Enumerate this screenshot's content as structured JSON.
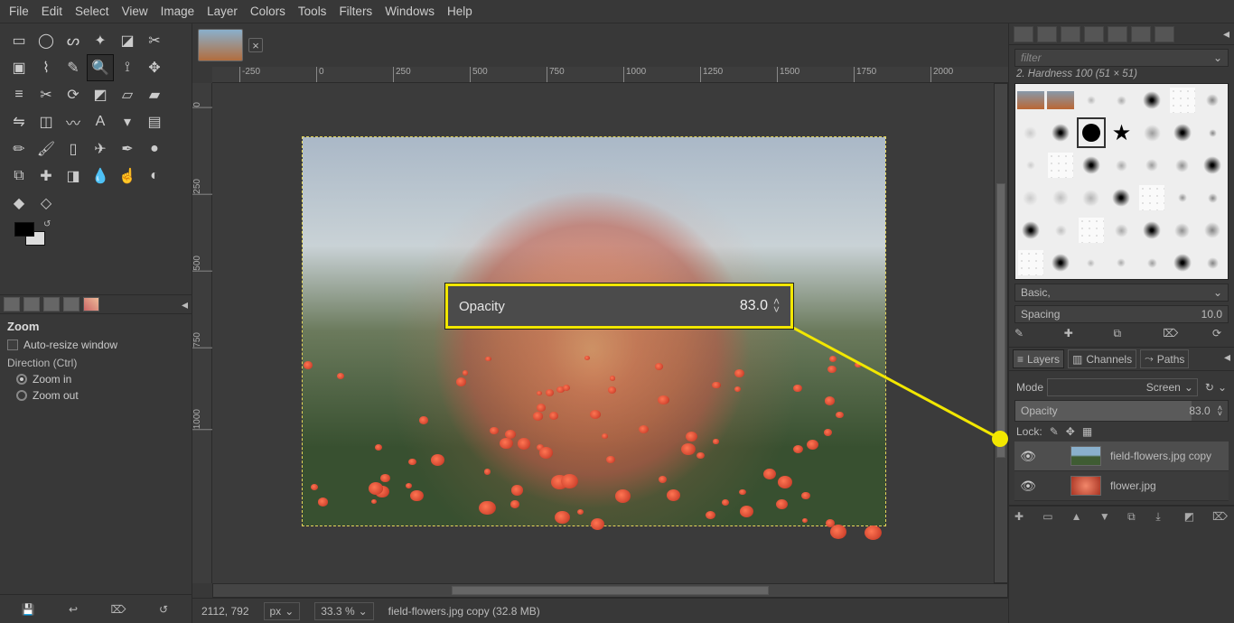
{
  "menu": [
    "File",
    "Edit",
    "Select",
    "View",
    "Image",
    "Layer",
    "Colors",
    "Tools",
    "Filters",
    "Windows",
    "Help"
  ],
  "toolbox": {
    "rows": [
      [
        "rect-select",
        "ellipse-select",
        "free-select",
        "fuzzy-select",
        "color-select",
        "scissors"
      ],
      [
        "foreground-select",
        "paths",
        "color-picker",
        "zoom",
        "measure",
        "move"
      ],
      [
        "align",
        "crop",
        "rotate",
        "scale",
        "shear",
        "perspective"
      ],
      [
        "flip",
        "cage",
        "warp",
        "text",
        "bucket",
        "gradient"
      ],
      [
        "pencil",
        "paintbrush",
        "eraser",
        "airbrush",
        "ink",
        "mypaint"
      ],
      [
        "clone",
        "heal",
        "perspective-clone",
        "blur",
        "smudge",
        "dodge"
      ],
      [
        "more1",
        "more2",
        "",
        "",
        "",
        ""
      ]
    ],
    "selected": "zoom"
  },
  "tool_options": {
    "title": "Zoom",
    "auto_resize_label": "Auto-resize window",
    "auto_resize": false,
    "direction_label": "Direction  (Ctrl)",
    "zoom_in_label": "Zoom in",
    "zoom_out_label": "Zoom out",
    "direction": "in"
  },
  "ruler_h": [
    -250,
    0,
    250,
    500,
    750,
    1000,
    1250,
    1500,
    1750,
    2000
  ],
  "ruler_v": [
    0,
    250,
    500,
    750,
    1000
  ],
  "statusbar": {
    "coords": "2112, 792",
    "unit": "px",
    "zoom": "33.3 %",
    "file": "field-flowers.jpg copy (32.8 MB)"
  },
  "right": {
    "filter_label": "filter",
    "brush_title": "2. Hardness 100 (51 × 51)",
    "brush_preset": "Basic,",
    "spacing_label": "Spacing",
    "spacing_value": "10.0",
    "dock_tabs": [
      "Layers",
      "Channels",
      "Paths"
    ],
    "dock_active": 0,
    "mode_label": "Mode",
    "mode_value": "Screen",
    "opacity_label": "Opacity",
    "opacity_value": "83.0",
    "lock_label": "Lock:",
    "layers": [
      {
        "visible": true,
        "name": "field-flowers.jpg copy",
        "selected": true,
        "thumb": "flowers"
      },
      {
        "visible": true,
        "name": "flower.jpg",
        "selected": false,
        "thumb": "flower"
      }
    ]
  },
  "callout": {
    "label": "Opacity",
    "value": "83.0"
  }
}
